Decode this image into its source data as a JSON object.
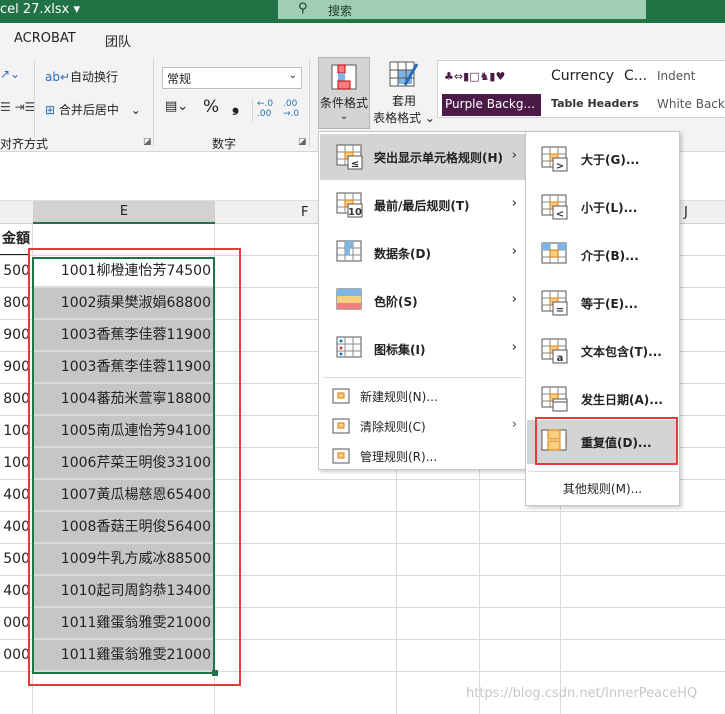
{
  "titlebar": {
    "filename": "cel 27.xlsx ▾",
    "search_placeholder": "搜索"
  },
  "tabs": [
    "ACROBAT",
    "团队"
  ],
  "ribbon": {
    "wrap_text": "自动换行",
    "merge_center": "合并后居中",
    "number_format": "常规",
    "percent": "%",
    "comma": "❟",
    "inc_decimal": "←.0 .00",
    "dec_decimal": ".00 →.0",
    "conditional_format": "条件格式",
    "conditional_format_chevron": "⌄",
    "table_format_line1": "套用",
    "table_format_line2": "表格格式 ⌄",
    "groups": {
      "alignment": "对齐方式",
      "number": "数字"
    },
    "styles": {
      "currency": "Currency",
      "c_trunc": "C...",
      "indent": "Indent",
      "purple": "Purple  Backg...",
      "table_headers": "Table Headers",
      "white": "White  Back"
    }
  },
  "colors": {
    "excel_green": "#217346",
    "purple_style": "#4b1a47",
    "highlight_red": "#e83a3a",
    "selection_fill": "#c6c6c6"
  },
  "columns": {
    "E": "E",
    "F": "F",
    "J": "J"
  },
  "sheet": {
    "header_partial": "金額",
    "col_d_partial": [
      "500",
      "800",
      "900",
      "900",
      "800",
      "100",
      "100",
      "400",
      "400",
      "500",
      "400",
      "000",
      "000"
    ],
    "col_e": [
      "1001柳橙連怡芳74500",
      "1002蘋果樊淑娟68800",
      "1003香蕉李佳蓉11900",
      "1003香蕉李佳蓉11900",
      "1004蕃茄米萱寧18800",
      "1005南瓜連怡芳94100",
      "1006芹菜王明俊33100",
      "1007黃瓜楊慈恩65400",
      "1008香菇王明俊56400",
      "1009牛乳方威冰88500",
      "1010起司周鈞恭13400",
      "1011雞蛋翁雅雯21000",
      "1011雞蛋翁雅雯21000"
    ]
  },
  "menu": {
    "items": [
      "突出显示单元格规则(H)",
      "最前/最后规则(T)",
      "数据条(D)",
      "色阶(S)",
      "图标集(I)"
    ],
    "small_items": [
      "新建规则(N)...",
      "清除规则(C)",
      "管理规则(R)..."
    ]
  },
  "submenu": {
    "items": [
      "大于(G)...",
      "小于(L)...",
      "介于(B)...",
      "等于(E)...",
      "文本包含(T)...",
      "发生日期(A)...",
      "重复值(D)..."
    ],
    "more": "其他规则(M)..."
  },
  "watermark": "https://blog.csdn.net/InnerPeaceHQ"
}
